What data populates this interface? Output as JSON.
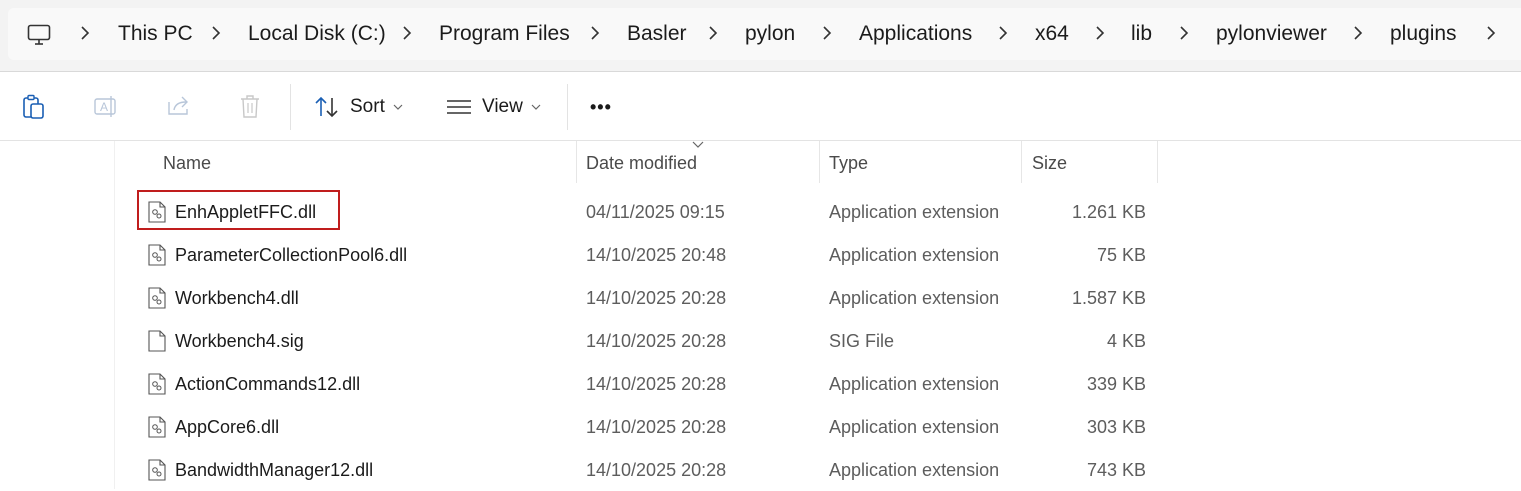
{
  "breadcrumb": {
    "items": [
      "This PC",
      "Local Disk (C:)",
      "Program Files",
      "Basler",
      "pylon",
      "Applications",
      "x64",
      "lib",
      "pylonviewer",
      "plugins"
    ]
  },
  "commandbar": {
    "sort_label": "Sort",
    "view_label": "View",
    "more_label": "•••"
  },
  "columns": {
    "name": "Name",
    "date": "Date modified",
    "type": "Type",
    "size": "Size"
  },
  "files": [
    {
      "name": "EnhAppletFFC.dll",
      "date": "04/11/2025 09:15",
      "type": "Application extension",
      "size": "1.261 KB",
      "icon": "dll-file-icon"
    },
    {
      "name": "ParameterCollectionPool6.dll",
      "date": "14/10/2025 20:48",
      "type": "Application extension",
      "size": "75 KB",
      "icon": "dll-file-icon"
    },
    {
      "name": "Workbench4.dll",
      "date": "14/10/2025 20:28",
      "type": "Application extension",
      "size": "1.587 KB",
      "icon": "dll-file-icon"
    },
    {
      "name": "Workbench4.sig",
      "date": "14/10/2025 20:28",
      "type": "SIG File",
      "size": "4 KB",
      "icon": "generic-file-icon"
    },
    {
      "name": "ActionCommands12.dll",
      "date": "14/10/2025 20:28",
      "type": "Application extension",
      "size": "339 KB",
      "icon": "dll-file-icon"
    },
    {
      "name": "AppCore6.dll",
      "date": "14/10/2025 20:28",
      "type": "Application extension",
      "size": "303 KB",
      "icon": "dll-file-icon"
    },
    {
      "name": "BandwidthManager12.dll",
      "date": "14/10/2025 20:28",
      "type": "Application extension",
      "size": "743 KB",
      "icon": "dll-file-icon"
    }
  ],
  "colors": {
    "highlight": "#c01d1d",
    "accent": "#0067c0"
  }
}
